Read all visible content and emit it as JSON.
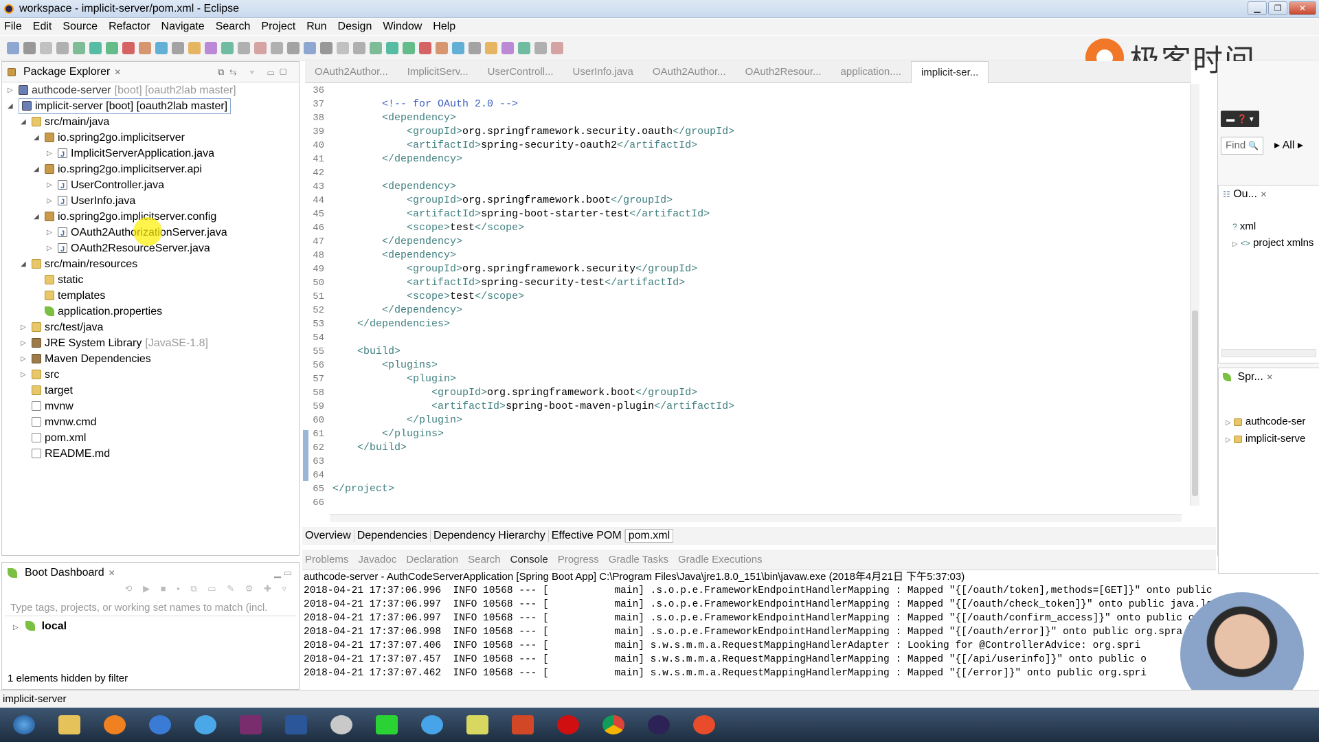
{
  "window": {
    "title": "workspace - implicit-server/pom.xml - Eclipse"
  },
  "menu": [
    "File",
    "Edit",
    "Source",
    "Refactor",
    "Navigate",
    "Search",
    "Project",
    "Run",
    "Design",
    "Window",
    "Help"
  ],
  "watermark": {
    "brand_text": "极客时间"
  },
  "package_explorer": {
    "title": "Package Explorer",
    "items": [
      {
        "label": "authcode-server",
        "suffix": "[boot] [oauth2lab master]",
        "icon": "project-icon",
        "depth": 0,
        "twisty": "▷",
        "muted": true
      },
      {
        "label": "implicit-server [boot] [oauth2lab master]",
        "suffix": "",
        "icon": "project-icon",
        "depth": 0,
        "twisty": "◢",
        "selected": true
      },
      {
        "label": "src/main/java",
        "icon": "source-folder-icon",
        "depth": 1,
        "twisty": "◢"
      },
      {
        "label": "io.spring2go.implicitserver",
        "icon": "package-icon",
        "depth": 2,
        "twisty": "◢"
      },
      {
        "label": "ImplicitServerApplication.java",
        "icon": "java-file-icon",
        "depth": 3,
        "twisty": "▷"
      },
      {
        "label": "io.spring2go.implicitserver.api",
        "icon": "package-icon",
        "depth": 2,
        "twisty": "◢"
      },
      {
        "label": "UserController.java",
        "icon": "java-file-icon",
        "depth": 3,
        "twisty": "▷"
      },
      {
        "label": "UserInfo.java",
        "icon": "java-file-icon",
        "depth": 3,
        "twisty": "▷"
      },
      {
        "label": "io.spring2go.implicitserver.config",
        "icon": "package-icon",
        "depth": 2,
        "twisty": "◢"
      },
      {
        "label": "OAuth2AuthorizationServer.java",
        "icon": "java-file-icon",
        "depth": 3,
        "twisty": "▷"
      },
      {
        "label": "OAuth2ResourceServer.java",
        "icon": "java-file-icon",
        "depth": 3,
        "twisty": "▷"
      },
      {
        "label": "src/main/resources",
        "icon": "source-folder-icon",
        "depth": 1,
        "twisty": "◢"
      },
      {
        "label": "static",
        "icon": "folder-icon",
        "depth": 2,
        "twisty": ""
      },
      {
        "label": "templates",
        "icon": "folder-icon",
        "depth": 2,
        "twisty": ""
      },
      {
        "label": "application.properties",
        "icon": "properties-icon",
        "depth": 2,
        "twisty": ""
      },
      {
        "label": "src/test/java",
        "icon": "source-folder-icon",
        "depth": 1,
        "twisty": "▷"
      },
      {
        "label": "JRE System Library",
        "suffix": "[JavaSE-1.8]",
        "icon": "library-icon",
        "depth": 1,
        "twisty": "▷"
      },
      {
        "label": "Maven Dependencies",
        "icon": "library-icon",
        "depth": 1,
        "twisty": "▷"
      },
      {
        "label": "src",
        "icon": "folder-icon",
        "depth": 1,
        "twisty": "▷"
      },
      {
        "label": "target",
        "icon": "folder-icon",
        "depth": 1,
        "twisty": ""
      },
      {
        "label": "mvnw",
        "icon": "file-icon",
        "depth": 1,
        "twisty": ""
      },
      {
        "label": "mvnw.cmd",
        "icon": "file-icon",
        "depth": 1,
        "twisty": ""
      },
      {
        "label": "pom.xml",
        "icon": "xml-file-icon",
        "depth": 1,
        "twisty": ""
      },
      {
        "label": "README.md",
        "icon": "file-icon",
        "depth": 1,
        "twisty": ""
      }
    ]
  },
  "boot_dashboard": {
    "title": "Boot Dashboard",
    "filter_placeholder": "Type tags, projects, or working set names to match (incl.",
    "local_label": "local",
    "hidden_note": "1 elements hidden by filter"
  },
  "editor": {
    "tabs": [
      "OAuth2Author...",
      "ImplicitServ...",
      "UserControll...",
      "UserInfo.java",
      "OAuth2Author...",
      "OAuth2Resour...",
      "application....",
      "implicit-ser..."
    ],
    "lines": [
      {
        "n": "36",
        "indent": "",
        "parts": []
      },
      {
        "n": "37",
        "indent": "        ",
        "parts": [
          {
            "c": "cmt",
            "t": "<!-- for OAuth 2.0 -->"
          }
        ]
      },
      {
        "n": "38",
        "indent": "        ",
        "parts": [
          {
            "c": "tag",
            "t": "<dependency>"
          }
        ]
      },
      {
        "n": "39",
        "indent": "            ",
        "parts": [
          {
            "c": "tag",
            "t": "<groupId>"
          },
          {
            "c": "txt",
            "t": "org.springframework.security.oauth"
          },
          {
            "c": "tag",
            "t": "</groupId>"
          }
        ]
      },
      {
        "n": "40",
        "indent": "            ",
        "parts": [
          {
            "c": "tag",
            "t": "<artifactId>"
          },
          {
            "c": "txt",
            "t": "spring-security-oauth2"
          },
          {
            "c": "tag",
            "t": "</artifactId>"
          }
        ]
      },
      {
        "n": "41",
        "indent": "        ",
        "parts": [
          {
            "c": "tag",
            "t": "</dependency>"
          }
        ]
      },
      {
        "n": "42",
        "indent": "",
        "parts": []
      },
      {
        "n": "43",
        "indent": "        ",
        "parts": [
          {
            "c": "tag",
            "t": "<dependency>"
          }
        ]
      },
      {
        "n": "44",
        "indent": "            ",
        "parts": [
          {
            "c": "tag",
            "t": "<groupId>"
          },
          {
            "c": "txt",
            "t": "org.springframework.boot"
          },
          {
            "c": "tag",
            "t": "</groupId>"
          }
        ]
      },
      {
        "n": "45",
        "indent": "            ",
        "parts": [
          {
            "c": "tag",
            "t": "<artifactId>"
          },
          {
            "c": "txt",
            "t": "spring-boot-starter-test"
          },
          {
            "c": "tag",
            "t": "</artifactId>"
          }
        ]
      },
      {
        "n": "46",
        "indent": "            ",
        "parts": [
          {
            "c": "tag",
            "t": "<scope>"
          },
          {
            "c": "txt",
            "t": "test"
          },
          {
            "c": "tag",
            "t": "</scope>"
          }
        ]
      },
      {
        "n": "47",
        "indent": "        ",
        "parts": [
          {
            "c": "tag",
            "t": "</dependency>"
          }
        ]
      },
      {
        "n": "48",
        "indent": "        ",
        "parts": [
          {
            "c": "tag",
            "t": "<dependency>"
          }
        ]
      },
      {
        "n": "49",
        "indent": "            ",
        "parts": [
          {
            "c": "tag",
            "t": "<groupId>"
          },
          {
            "c": "txt",
            "t": "org.springframework.security"
          },
          {
            "c": "tag",
            "t": "</groupId>"
          }
        ]
      },
      {
        "n": "50",
        "indent": "            ",
        "parts": [
          {
            "c": "tag",
            "t": "<artifactId>"
          },
          {
            "c": "txt",
            "t": "spring-security-test"
          },
          {
            "c": "tag",
            "t": "</artifactId>"
          }
        ]
      },
      {
        "n": "51",
        "indent": "            ",
        "parts": [
          {
            "c": "tag",
            "t": "<scope>"
          },
          {
            "c": "txt",
            "t": "test"
          },
          {
            "c": "tag",
            "t": "</scope>"
          }
        ]
      },
      {
        "n": "52",
        "indent": "        ",
        "parts": [
          {
            "c": "tag",
            "t": "</dependency>"
          }
        ]
      },
      {
        "n": "53",
        "indent": "    ",
        "parts": [
          {
            "c": "tag",
            "t": "</dependencies>"
          }
        ]
      },
      {
        "n": "54",
        "indent": "",
        "parts": []
      },
      {
        "n": "55",
        "indent": "    ",
        "parts": [
          {
            "c": "tag",
            "t": "<build>"
          }
        ]
      },
      {
        "n": "56",
        "indent": "        ",
        "parts": [
          {
            "c": "tag",
            "t": "<plugins>"
          }
        ]
      },
      {
        "n": "57",
        "indent": "            ",
        "parts": [
          {
            "c": "tag",
            "t": "<plugin>"
          }
        ]
      },
      {
        "n": "58",
        "indent": "                ",
        "parts": [
          {
            "c": "tag",
            "t": "<groupId>"
          },
          {
            "c": "txt",
            "t": "org.springframework.boot"
          },
          {
            "c": "tag",
            "t": "</groupId>"
          }
        ]
      },
      {
        "n": "59",
        "indent": "                ",
        "parts": [
          {
            "c": "tag",
            "t": "<artifactId>"
          },
          {
            "c": "txt",
            "t": "spring-boot-maven-plugin"
          },
          {
            "c": "tag",
            "t": "</artifactId>"
          }
        ]
      },
      {
        "n": "60",
        "indent": "            ",
        "parts": [
          {
            "c": "tag",
            "t": "</plugin>"
          }
        ]
      },
      {
        "n": "61",
        "indent": "        ",
        "parts": [
          {
            "c": "tag",
            "t": "</plugins>"
          }
        ]
      },
      {
        "n": "62",
        "indent": "    ",
        "parts": [
          {
            "c": "tag",
            "t": "</build>"
          }
        ]
      },
      {
        "n": "63",
        "indent": "",
        "parts": []
      },
      {
        "n": "64",
        "indent": "",
        "parts": []
      },
      {
        "n": "65",
        "indent": "",
        "parts": [
          {
            "c": "tag",
            "t": "</project>"
          }
        ]
      },
      {
        "n": "66",
        "indent": "",
        "parts": []
      }
    ],
    "pom_tabs": [
      "Overview",
      "Dependencies",
      "Dependency Hierarchy",
      "Effective POM",
      "pom.xml"
    ]
  },
  "outline": {
    "title": "Ou...",
    "items": [
      "xml",
      "project xmlns"
    ]
  },
  "spring_view": {
    "title": "Spr...",
    "items": [
      "authcode-ser",
      "implicit-serve"
    ]
  },
  "find": {
    "placeholder": "Find",
    "all_label": "All"
  },
  "console": {
    "tabs": [
      "Problems",
      "Javadoc",
      "Declaration",
      "Search",
      "Console",
      "Progress",
      "Gradle Tasks",
      "Gradle Executions"
    ],
    "header": "authcode-server - AuthCodeServerApplication [Spring Boot App] C:\\Program Files\\Java\\jre1.8.0_151\\bin\\javaw.exe (2018年4月21日 下午5:37:03)",
    "lines": [
      "2018-04-21 17:37:06.996  INFO 10568 --- [           main] .s.o.p.e.FrameworkEndpointHandlerMapping : Mapped \"{[/oauth/token],methods=[GET]}\" onto public org.spra",
      "2018-04-21 17:37:06.997  INFO 10568 --- [           main] .s.o.p.e.FrameworkEndpointHandlerMapping : Mapped \"{[/oauth/check_token]}\" onto public java.lang",
      "2018-04-21 17:37:06.997  INFO 10568 --- [           main] .s.o.p.e.FrameworkEndpointHandlerMapping : Mapped \"{[/oauth/confirm_access]}\" onto public org",
      "2018-04-21 17:37:06.998  INFO 10568 --- [           main] .s.o.p.e.FrameworkEndpointHandlerMapping : Mapped \"{[/oauth/error]}\" onto public org.spra",
      "2018-04-21 17:37:07.406  INFO 10568 --- [           main] s.w.s.m.m.a.RequestMappingHandlerAdapter : Looking for @ControllerAdvice: org.spri",
      "2018-04-21 17:37:07.457  INFO 10568 --- [           main] s.w.s.m.m.a.RequestMappingHandlerMapping : Mapped \"{[/api/userinfo]}\" onto public o",
      "2018-04-21 17:37:07.462  INFO 10568 --- [           main] s.w.s.m.m.a.RequestMappingHandlerMapping : Mapped \"{[/error]}\" onto public org.spri"
    ]
  },
  "status": {
    "selected": "implicit-server"
  },
  "colors": {
    "accent_selection": "#cce0f7",
    "tag": "#3f7f7f",
    "comment": "#3f5fbf"
  }
}
